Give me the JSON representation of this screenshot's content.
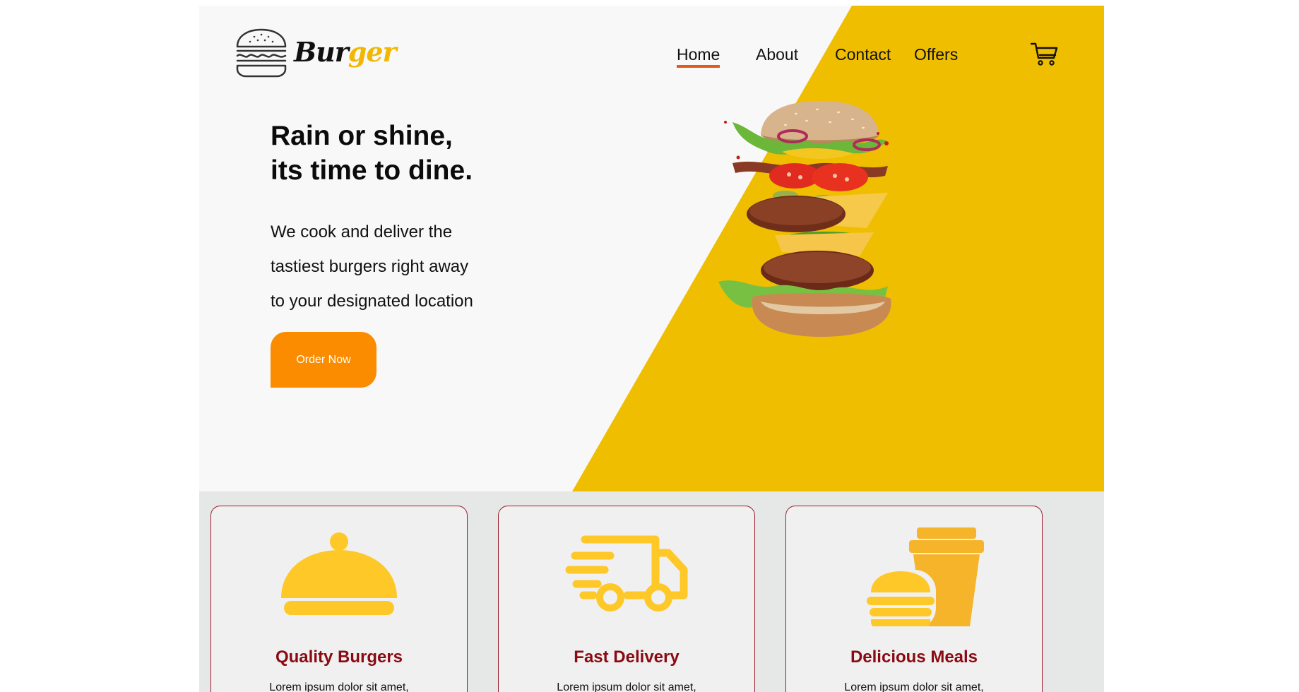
{
  "brand": {
    "logo_part1": "Bur",
    "logo_part2": "ger",
    "accent_color": "#f0be00",
    "button_color": "#fb8c00",
    "title_color": "#8a0a12"
  },
  "nav": {
    "items": [
      {
        "label": "Home",
        "active": true
      },
      {
        "label": "About",
        "active": false
      },
      {
        "label": "Contact",
        "active": false
      },
      {
        "label": "Offers",
        "active": false
      }
    ],
    "cart_icon": "shopping-cart-icon"
  },
  "hero": {
    "title_line1": "Rain or shine,",
    "title_line2": "its time to dine.",
    "desc_line1": "We cook and deliver the",
    "desc_line2": "tastiest burgers right away",
    "desc_line3": "to your designated location",
    "cta_label": "Order Now",
    "image": "flying-burger-ingredients-image"
  },
  "features": [
    {
      "icon": "serving-cloche-icon",
      "title": "Quality Burgers",
      "text": "Lorem ipsum dolor sit amet,"
    },
    {
      "icon": "delivery-truck-icon",
      "title": "Fast Delivery",
      "text": "Lorem ipsum dolor sit amet,"
    },
    {
      "icon": "burger-and-drink-icon",
      "title": "Delicious Meals",
      "text": "Lorem ipsum dolor sit amet,"
    }
  ]
}
